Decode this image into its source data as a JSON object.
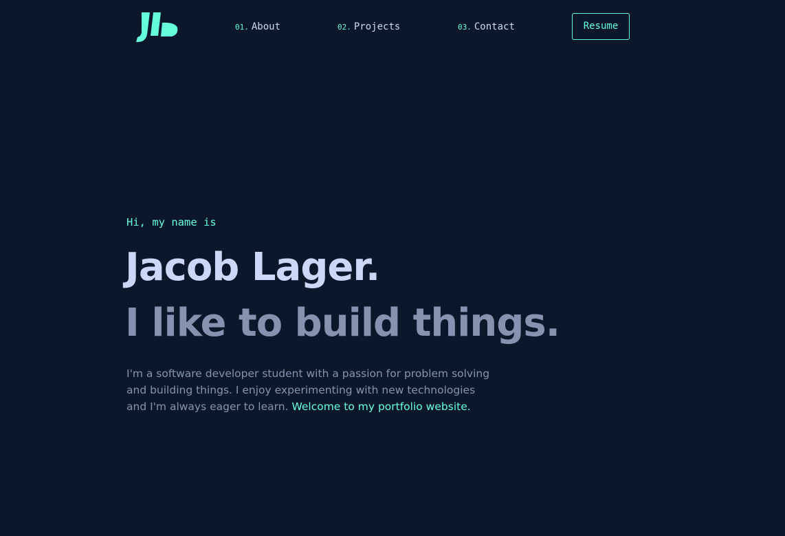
{
  "logo": {
    "icon": "jl-logo-icon",
    "color": "#64ffda"
  },
  "nav": {
    "items": [
      {
        "number": "01.",
        "label": "About"
      },
      {
        "number": "02.",
        "label": "Projects"
      },
      {
        "number": "03.",
        "label": "Contact"
      }
    ],
    "resume_label": "Resume"
  },
  "hero": {
    "greeting": "Hi, my name is",
    "name": "Jacob Lager.",
    "tagline": "I like to build things.",
    "intro_lines": [
      "I'm a software developer student with a passion for problem solving",
      "and building things. I enjoy experimenting with new technologies",
      "and I'm always eager to learn."
    ],
    "intro_highlight": "Welcome to my portfolio website."
  },
  "colors": {
    "background": "#0d172c",
    "accent": "#64ffda",
    "heading": "#ccd6f6",
    "body_text": "#8892b0"
  }
}
